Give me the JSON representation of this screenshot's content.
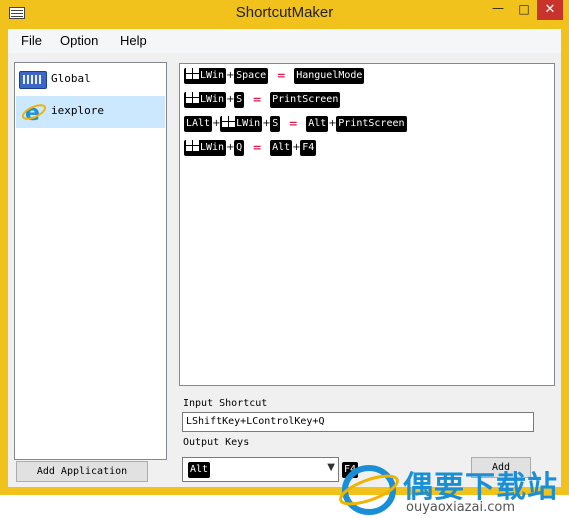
{
  "window": {
    "title": "ShortcutMaker",
    "min_glyph": "—",
    "max_glyph": "□",
    "close_glyph": "✕"
  },
  "menu": [
    "File",
    "Option",
    "Help"
  ],
  "apps": [
    {
      "label": "Global",
      "icon": "keyboard-icon",
      "selected": false
    },
    {
      "label": "iexplore",
      "icon": "internet-explorer-icon",
      "selected": true
    }
  ],
  "rules": [
    {
      "input": [
        "LWin",
        "Space"
      ],
      "output": [
        "HanguelMode"
      ]
    },
    {
      "input": [
        "LWin",
        "S"
      ],
      "output": [
        "PrintScreen"
      ]
    },
    {
      "input": [
        "LAlt",
        "LWin",
        "S"
      ],
      "output": [
        "Alt",
        "PrintScreen"
      ]
    },
    {
      "input": [
        "LWin",
        "Q"
      ],
      "output": [
        "Alt",
        "F4"
      ]
    }
  ],
  "rule_symbols": {
    "plus": "+",
    "equals": "="
  },
  "input_shortcut": {
    "label": "Input Shortcut",
    "value": "LShiftKey+LControlKey+Q"
  },
  "output_keys": {
    "label": "Output Keys",
    "selected": "Alt",
    "extra_key": "F4"
  },
  "buttons": {
    "add_application": "Add Application",
    "add": "Add"
  },
  "watermark": {
    "cn": "偶要下载站",
    "en": "ouyaoxiazai.com"
  },
  "colors": {
    "titlebar": "#f0c21b",
    "close": "#c7342c",
    "selection": "#cce8ff",
    "equals": "#e0194a",
    "key_bg": "#000000",
    "watermark": "#1a8fd6"
  }
}
